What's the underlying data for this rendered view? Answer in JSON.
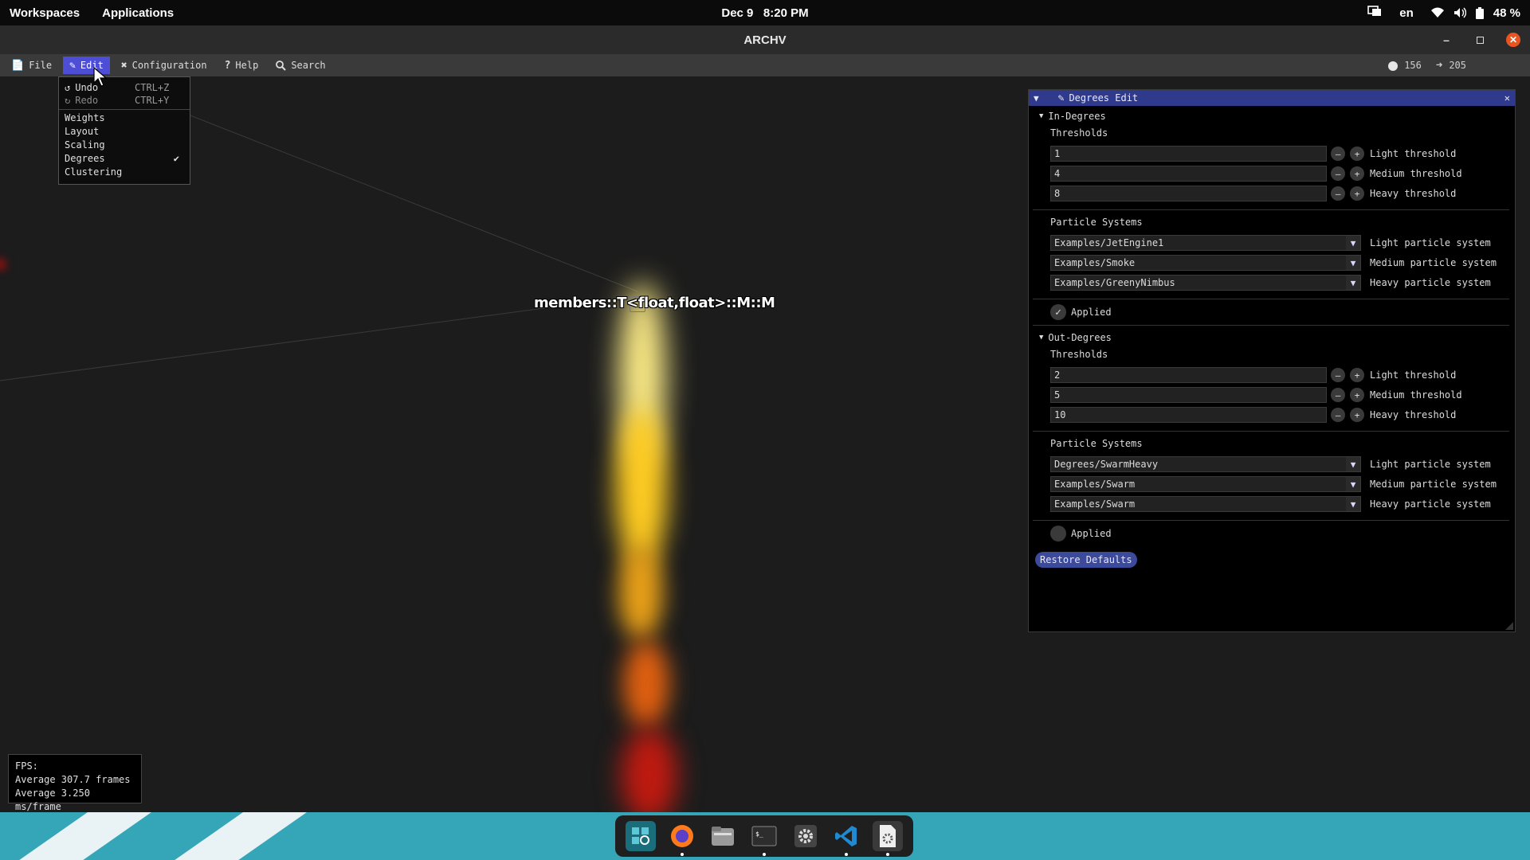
{
  "topbar": {
    "workspaces": "Workspaces",
    "applications": "Applications",
    "date": "Dec 9",
    "time": "8:20 PM",
    "language": "en",
    "battery": "48 %"
  },
  "window": {
    "title": "ARCHV"
  },
  "menubar": {
    "items": [
      {
        "label": "File",
        "icon": "file-icon"
      },
      {
        "label": "Edit",
        "icon": "pencil-icon"
      },
      {
        "label": "Configuration",
        "icon": "tools-icon"
      },
      {
        "label": "Help",
        "icon": "question-icon"
      },
      {
        "label": "Search",
        "icon": "search-icon"
      }
    ],
    "node_count": "156",
    "edge_count": "205"
  },
  "edit_menu": {
    "undo": "Undo",
    "undo_shortcut": "CTRL+Z",
    "redo": "Redo",
    "redo_shortcut": "CTRL+Y",
    "items": [
      "Weights",
      "Layout",
      "Scaling",
      "Degrees",
      "Clustering"
    ],
    "checked": "Degrees"
  },
  "scene": {
    "node_label": "members::T<float,float>::M::M"
  },
  "degrees_edit": {
    "title": "Degrees Edit",
    "in": {
      "header": "In-Degrees",
      "thresholds_label": "Thresholds",
      "thresholds": [
        {
          "value": "1",
          "label": "Light threshold"
        },
        {
          "value": "4",
          "label": "Medium threshold"
        },
        {
          "value": "8",
          "label": "Heavy threshold"
        }
      ],
      "particles_label": "Particle Systems",
      "particles": [
        {
          "value": "Examples/JetEngine1",
          "label": "Light particle system"
        },
        {
          "value": "Examples/Smoke",
          "label": "Medium particle system"
        },
        {
          "value": "Examples/GreenyNimbus",
          "label": "Heavy particle system"
        }
      ],
      "applied_label": "Applied",
      "applied": true
    },
    "out": {
      "header": "Out-Degrees",
      "thresholds_label": "Thresholds",
      "thresholds": [
        {
          "value": "2",
          "label": "Light threshold"
        },
        {
          "value": "5",
          "label": "Medium threshold"
        },
        {
          "value": "10",
          "label": "Heavy threshold"
        }
      ],
      "particles_label": "Particle Systems",
      "particles": [
        {
          "value": "Degrees/SwarmHeavy",
          "label": "Light particle system"
        },
        {
          "value": "Examples/Swarm",
          "label": "Medium particle system"
        },
        {
          "value": "Examples/Swarm",
          "label": "Heavy particle system"
        }
      ],
      "applied_label": "Applied",
      "applied": false
    },
    "restore_defaults": "Restore Defaults"
  },
  "fps": {
    "label": "FPS:",
    "frames": "Average 307.7 frames",
    "ms": "Average 3.250 ms/frame"
  },
  "dock": {
    "apps": [
      "search-app-icon",
      "firefox-icon",
      "files-icon",
      "terminal-icon",
      "settings-icon",
      "vscode-icon",
      "archv-app-icon"
    ]
  }
}
